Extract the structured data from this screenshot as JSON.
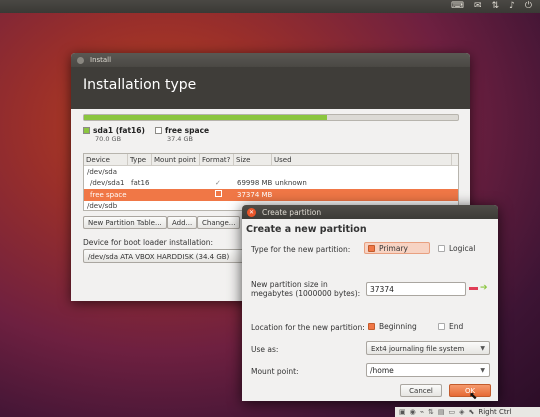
{
  "top_panel": {
    "icons": [
      "keyboard-icon",
      "mail-icon",
      "network-icon",
      "volume-icon",
      "power-icon"
    ]
  },
  "install": {
    "window_title": "Install",
    "header": "Installation type",
    "progress_fraction": 0.65,
    "legend": [
      {
        "name": "sda1 (fat16)",
        "size": "70.0 GB",
        "color": "#8bc63f"
      },
      {
        "name": "free space",
        "size": "37.4 GB",
        "color": "#ffffff"
      }
    ],
    "table": {
      "headers": [
        "Device",
        "Type",
        "Mount point",
        "Format?",
        "Size",
        "Used"
      ],
      "rows": [
        {
          "device": "/dev/sda",
          "type": "",
          "mount": "",
          "format": "",
          "size": "",
          "used": ""
        },
        {
          "device": "/dev/sda1",
          "type": "fat16",
          "mount": "",
          "format": "✓",
          "size": "69998 MB",
          "used": "unknown"
        },
        {
          "device": "free space",
          "type": "",
          "mount": "",
          "format": "",
          "size": "37374 MB",
          "used": ""
        },
        {
          "device": "/dev/sdb",
          "type": "",
          "mount": "",
          "format": "",
          "size": "",
          "used": ""
        }
      ]
    },
    "buttons": {
      "new_table": "New Partition Table...",
      "add": "Add...",
      "change": "Change..."
    },
    "boot_label": "Device for boot loader installation:",
    "boot_device": "/dev/sda   ATA VBOX HARDDISK (34.4 GB)"
  },
  "dialog": {
    "title": "Create partition",
    "heading": "Create a new partition",
    "type_label": "Type for the new partition:",
    "type_options": [
      "Primary",
      "Logical"
    ],
    "type_selected": "Primary",
    "size_label_1": "New partition size in",
    "size_label_2": "megabytes (1000000 bytes):",
    "size_value": "37374",
    "location_label": "Location for the new partition:",
    "location_options": [
      "Beginning",
      "End"
    ],
    "location_selected": "Beginning",
    "use_as_label": "Use as:",
    "use_as_value": "Ext4 journaling file system",
    "mount_label": "Mount point:",
    "mount_value": "/home",
    "cancel": "Cancel",
    "ok": "OK"
  },
  "tray": {
    "right_ctrl": "Right Ctrl"
  }
}
